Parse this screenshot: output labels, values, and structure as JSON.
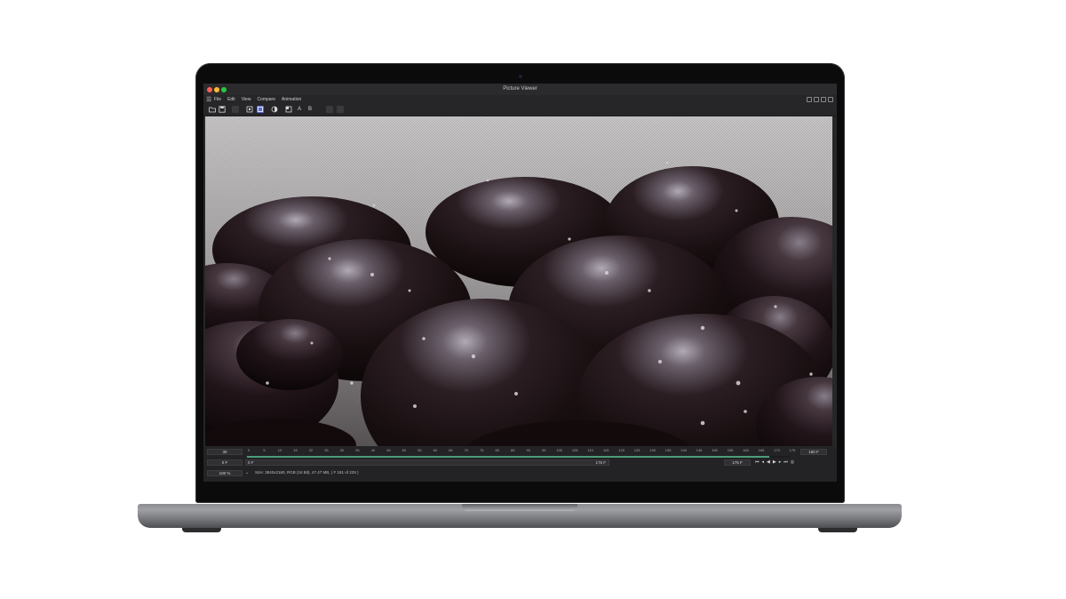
{
  "window": {
    "title": "Picture Viewer"
  },
  "menu": {
    "items": [
      "File",
      "Edit",
      "View",
      "Compare",
      "Animation"
    ]
  },
  "toolbar": {
    "letter_a": "A",
    "letter_b": "B"
  },
  "timeline": {
    "start_frame": "30",
    "end_frame": "180 F",
    "ticks": [
      "0",
      "5",
      "10",
      "15",
      "22",
      "25",
      "30",
      "35",
      "40",
      "45",
      "50",
      "55",
      "60",
      "65",
      "70",
      "75",
      "80",
      "85",
      "90",
      "95",
      "100",
      "105",
      "110",
      "115",
      "120",
      "125",
      "130",
      "135",
      "140",
      "145",
      "150",
      "155",
      "160",
      "165",
      "170",
      "175"
    ],
    "progress": 0.96,
    "current_frame": "0 F",
    "range_start": "0 F",
    "range_end": "175 F",
    "playhead_frame": "175 F"
  },
  "zoom": {
    "value": "100 %"
  },
  "status": {
    "text": "Size: 3840x2160, RGB (16 Bit), 47.47 MB, ( F 181 of 229 )"
  },
  "colors": {
    "traffic_red": "#ff5f57",
    "traffic_yellow": "#febc2e",
    "traffic_green": "#28c840",
    "progress": "#4a9e7a",
    "toolbar_active": "#5b6bd6"
  }
}
